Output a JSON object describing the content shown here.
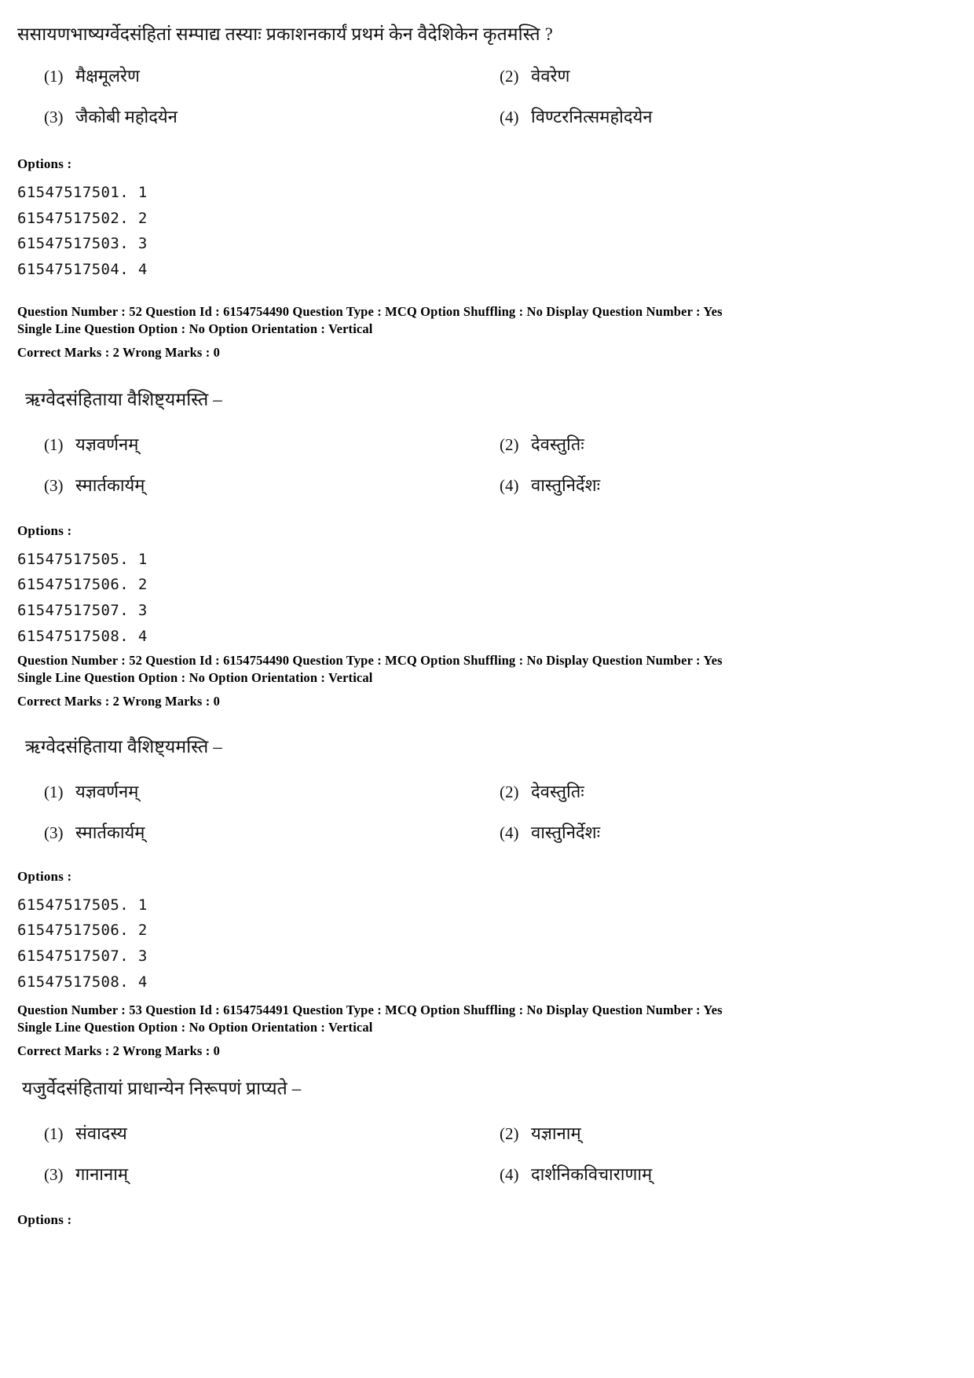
{
  "document": {
    "type": "exam-question-paper",
    "language": "Sanskrit"
  },
  "questions": [
    {
      "id": "q51",
      "stem": "ससायणभाष्यर्ग्वेदसंहितां सम्पाद्य तस्याः प्रकाशनकार्यं प्रथमं केन वैदेशिकेन कृतमस्ति ?",
      "choices": [
        {
          "num": "(1)",
          "text": "मैक्षमूलरेण"
        },
        {
          "num": "(2)",
          "text": "वेवरेण"
        },
        {
          "num": "(3)",
          "text": "जैकोबी महोदयेन"
        },
        {
          "num": "(4)",
          "text": "विण्टरनित्समहोदयेन"
        }
      ],
      "options_label": "Options :",
      "option_ids": [
        "61547517501. 1",
        "61547517502. 2",
        "61547517503. 3",
        "61547517504. 4"
      ]
    },
    {
      "id": "q52a",
      "meta_line_1": "Question Number : 52  Question Id : 6154754490  Question Type : MCQ  Option Shuffling : No  Display Question Number : Yes",
      "meta_line_2": "Single Line Question Option : No  Option Orientation : Vertical",
      "meta_marks": "Correct Marks : 2  Wrong Marks : 0",
      "stem": "ऋग्वेदसंहिताया वैशिष्ट्यमस्ति –",
      "choices": [
        {
          "num": "(1)",
          "text": "यज्ञवर्णनम्"
        },
        {
          "num": "(2)",
          "text": "देवस्तुतिः"
        },
        {
          "num": "(3)",
          "text": "स्मार्तकार्यम्"
        },
        {
          "num": "(4)",
          "text": "वास्तुनिर्देशः"
        }
      ],
      "options_label": "Options :",
      "option_ids": [
        "61547517505. 1",
        "61547517506. 2",
        "61547517507. 3",
        "61547517508. 4"
      ]
    },
    {
      "id": "q52b",
      "meta_line_1": "Question Number : 52  Question Id : 6154754490  Question Type : MCQ  Option Shuffling : No  Display Question Number : Yes",
      "meta_line_2": "Single Line Question Option : No  Option Orientation : Vertical",
      "meta_marks": "Correct Marks : 2  Wrong Marks : 0",
      "stem": "ऋग्वेदसंहिताया वैशिष्ट्यमस्ति –",
      "choices": [
        {
          "num": "(1)",
          "text": "यज्ञवर्णनम्"
        },
        {
          "num": "(2)",
          "text": "देवस्तुतिः"
        },
        {
          "num": "(3)",
          "text": "स्मार्तकार्यम्"
        },
        {
          "num": "(4)",
          "text": "वास्तुनिर्देशः"
        }
      ],
      "options_label": "Options :",
      "option_ids": [
        "61547517505. 1",
        "61547517506. 2",
        "61547517507. 3",
        "61547517508. 4"
      ]
    },
    {
      "id": "q53",
      "meta_line_1": "Question Number : 53  Question Id : 6154754491  Question Type : MCQ  Option Shuffling : No  Display Question Number : Yes",
      "meta_line_2": "Single Line Question Option : No  Option Orientation : Vertical",
      "meta_marks": "Correct Marks : 2  Wrong Marks : 0",
      "stem": "यजुर्वेदसंहितायां प्राधान्येन निरूपणं प्राप्यते –",
      "choices": [
        {
          "num": "(1)",
          "text": "संवादस्य"
        },
        {
          "num": "(2)",
          "text": "यज्ञानाम्"
        },
        {
          "num": "(3)",
          "text": "गानानाम्"
        },
        {
          "num": "(4)",
          "text": "दार्शनिकविचाराणाम्"
        }
      ],
      "options_label": "Options :"
    }
  ]
}
